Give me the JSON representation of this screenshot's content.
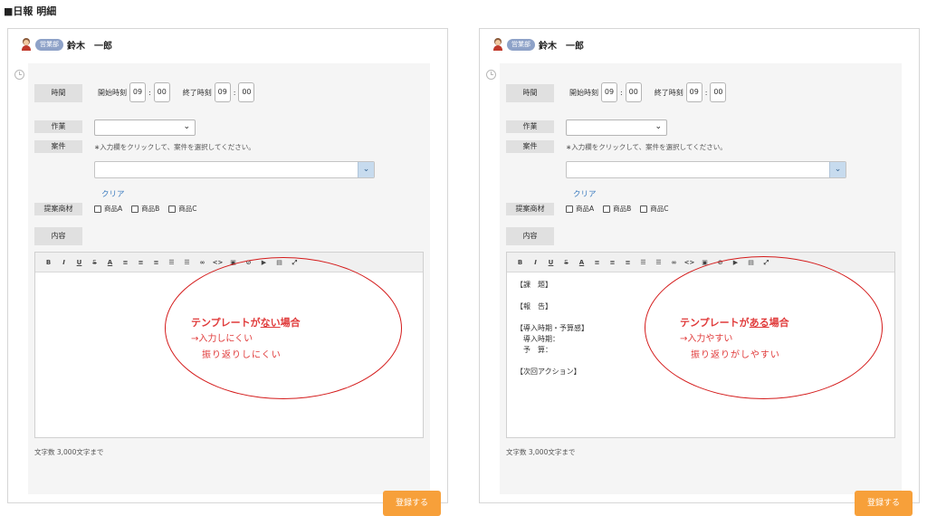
{
  "page_title": "■日報 明細",
  "panels": [
    {
      "user": {
        "dept": "営業部",
        "name": "鈴木　一郎"
      },
      "labels": {
        "time": "時間",
        "work": "作業",
        "case": "案件",
        "material": "提案商材",
        "content": "内容"
      },
      "time": {
        "start_label": "開始時刻",
        "start_hour": "09",
        "start_min": "00",
        "end_label": "終了時刻",
        "end_hour": "09",
        "end_min": "00",
        "sep": ":"
      },
      "work_select": {
        "value": ""
      },
      "case_hint": "∗入力欄をクリックして、案件を選択してください。",
      "case_select": {
        "value": ""
      },
      "clear_label": "クリア",
      "materials": [
        "商品A",
        "商品B",
        "商品C"
      ],
      "toolbar": [
        "B",
        "I",
        "U",
        "S",
        "A",
        "≡",
        "≡",
        "≡",
        "☰",
        "☰",
        "∞",
        "<>",
        "▣",
        "⊘",
        "▶",
        "▤",
        "⤢"
      ],
      "editor_lines": [],
      "note": {
        "head_pre": "テンプレートが",
        "head_emph": "ない",
        "head_post": "場合",
        "line2": "→入力しにくい",
        "line3": "振り返りしにくい"
      },
      "char_limit": "文字数 3,000文字まで",
      "submit_label": "登録する"
    },
    {
      "user": {
        "dept": "営業部",
        "name": "鈴木　一郎"
      },
      "labels": {
        "time": "時間",
        "work": "作業",
        "case": "案件",
        "material": "提案商材",
        "content": "内容"
      },
      "time": {
        "start_label": "開始時刻",
        "start_hour": "09",
        "start_min": "00",
        "end_label": "終了時刻",
        "end_hour": "09",
        "end_min": "00",
        "sep": ":"
      },
      "work_select": {
        "value": ""
      },
      "case_hint": "∗入力欄をクリックして、案件を選択してください。",
      "case_select": {
        "value": ""
      },
      "clear_label": "クリア",
      "materials": [
        "商品A",
        "商品B",
        "商品C"
      ],
      "toolbar": [
        "B",
        "I",
        "U",
        "S",
        "A",
        "≡",
        "≡",
        "≡",
        "☰",
        "☰",
        "∞",
        "<>",
        "▣",
        "⊘",
        "▶",
        "▤",
        "⤢"
      ],
      "editor_lines": [
        "【課　題】",
        "",
        "【報　告】",
        "",
        "【導入時期・予算感】",
        "　導入時期：",
        "　予　算：",
        "",
        "【次回アクション】"
      ],
      "note": {
        "head_pre": "テンプレートが",
        "head_emph": "ある",
        "head_post": "場合",
        "line2": "→入力やすい",
        "line3": "振り返りがしやすい"
      },
      "char_limit": "文字数 3,000文字まで",
      "submit_label": "登録する"
    }
  ]
}
